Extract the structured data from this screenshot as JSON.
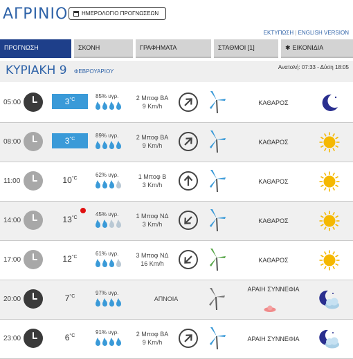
{
  "header": {
    "city": "ΑΓΡΙΝΙΟ",
    "calendar_button": "ΗΜΕΡΟΛΟΓΙΟ ΠΡΟΓΝΩΣΕΩΝ",
    "print_link": "ΕΚΤΥΠΩΣΗ",
    "separator": "|",
    "english_link": "ENGLISH VERSION"
  },
  "tabs": [
    {
      "label": "ΠΡΟΓΝΩΣΗ",
      "active": true
    },
    {
      "label": "ΣΚΟΝΗ",
      "active": false
    },
    {
      "label": "ΓΡΑΦΗΜΑΤΑ",
      "active": false
    },
    {
      "label": "ΣΤΑΘΜΟΙ [1]",
      "active": false
    },
    {
      "label": "ΕΙΚΟΝΙΔΙΑ",
      "active": false
    }
  ],
  "day": {
    "name": "ΚΥΡΙΑΚΗ 9",
    "month": "ΦΕΒΡΟΥΑΡΙΟΥ",
    "sun_times": "Ανατολή: 07:33  - Δύση 18:05"
  },
  "unit_celsius": "°C",
  "rows": [
    {
      "time": "05:00",
      "temp": "3",
      "humidity": "85% υγρ.",
      "drops": 4,
      "wind": "2 Μποφ ΒΑ",
      "speed": "9 Km/h",
      "condition": "ΚΑΘΑΡΟΣ",
      "icon": "moon-icon"
    },
    {
      "time": "08:00",
      "temp": "3",
      "humidity": "89% υγρ.",
      "drops": 4,
      "wind": "2 Μποφ ΒΑ",
      "speed": "9 Km/h",
      "condition": "ΚΑΘΑΡΟΣ",
      "icon": "sun-icon"
    },
    {
      "time": "11:00",
      "temp": "10",
      "humidity": "62% υγρ.",
      "drops": 3,
      "wind": "1 Μποφ Β",
      "speed": "3 Km/h",
      "condition": "ΚΑΘΑΡΟΣ",
      "icon": "sun-icon"
    },
    {
      "time": "14:00",
      "temp": "13",
      "humidity": "45% υγρ.",
      "drops": 2,
      "wind": "1 Μποφ ΝΔ",
      "speed": "3 Km/h",
      "condition": "ΚΑΘΑΡΟΣ",
      "icon": "sun-icon"
    },
    {
      "time": "17:00",
      "temp": "12",
      "humidity": "61% υγρ.",
      "drops": 3,
      "wind": "3 Μποφ ΝΔ",
      "speed": "16 Km/h",
      "condition": "ΚΑΘΑΡΟΣ",
      "icon": "sun-icon"
    },
    {
      "time": "20:00",
      "temp": "7",
      "humidity": "97% υγρ.",
      "drops": 4,
      "wind": "ΑΠΝΟΙΑ",
      "speed": "",
      "condition": "ΑΡΑΙΗ ΣΥΝΝΕΦΙΑ",
      "icon": "moon-cloud-icon"
    },
    {
      "time": "23:00",
      "temp": "6",
      "humidity": "91% υγρ.",
      "drops": 4,
      "wind": "2 Μποφ ΒΑ",
      "speed": "9 Km/h",
      "condition": "ΑΡΑΙΗ ΣΥΝΝΕΦΙΑ",
      "icon": "moon-cloud-icon"
    }
  ],
  "colors": {
    "brand_blue": "#2f63a8",
    "active_tab": "#1e3f8a",
    "temp_highlight": "#3a9ad8",
    "sun": "#f5b800",
    "moon": "#2a2f8f"
  }
}
